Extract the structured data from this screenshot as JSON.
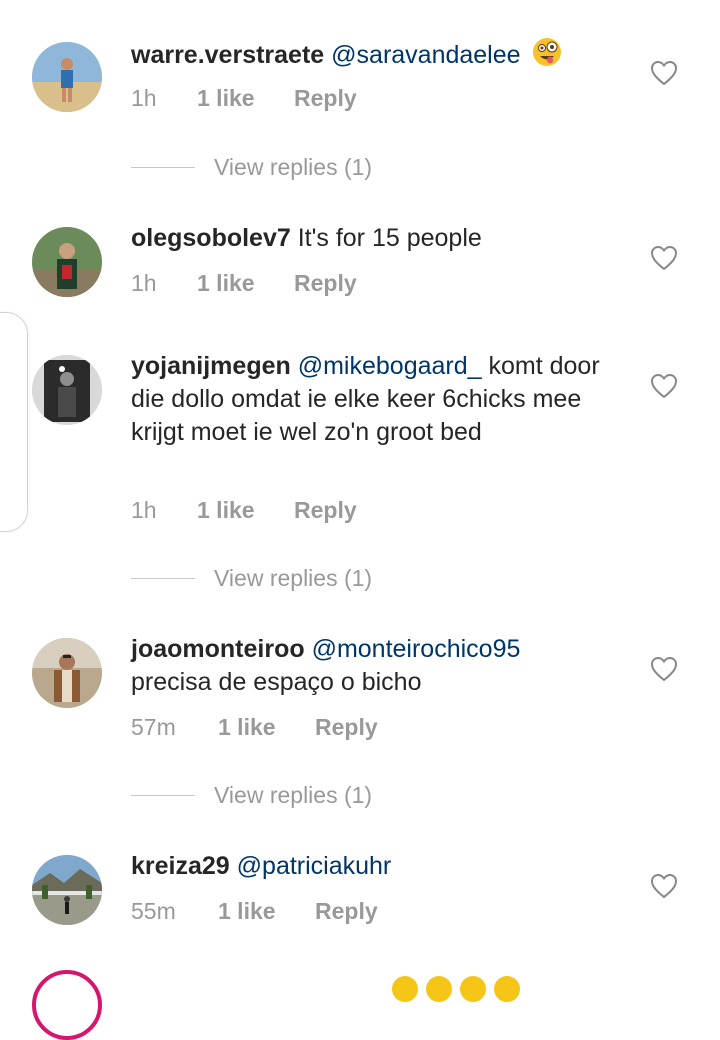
{
  "comments": [
    {
      "username": "warre.verstraete",
      "mention": "@saravandaelee",
      "text": "",
      "emoji": "zany-face",
      "time": "1h",
      "likes": "1 like",
      "reply": "Reply",
      "view_replies": "View replies (1)"
    },
    {
      "username": "olegsobolev7",
      "mention": "",
      "text": "It's for 15 people",
      "time": "1h",
      "likes": "1 like",
      "reply": "Reply"
    },
    {
      "username": "yojanijmegen",
      "mention": "@mikebogaard_",
      "text": "komt door die dollo omdat ie elke keer 6chicks mee krijgt moet ie wel zo'n groot bed",
      "time": "1h",
      "likes": "1 like",
      "reply": "Reply",
      "view_replies": "View replies (1)"
    },
    {
      "username": "joaomonteiroo",
      "mention": "@monteirochico95",
      "text": "precisa de espaço o bicho",
      "time": "57m",
      "likes": "1 like",
      "reply": "Reply",
      "view_replies": "View replies (1)"
    },
    {
      "username": "kreiza29",
      "mention": "@patriciakuhr",
      "text": "",
      "time": "55m",
      "likes": "1 like",
      "reply": "Reply"
    }
  ],
  "colors": {
    "text": "#262626",
    "mention": "#003569",
    "secondary": "#999999",
    "story_ring": "#d6166c"
  },
  "icons": {
    "like": "heart-outline-icon",
    "emoji": "zany-face-emoji"
  }
}
